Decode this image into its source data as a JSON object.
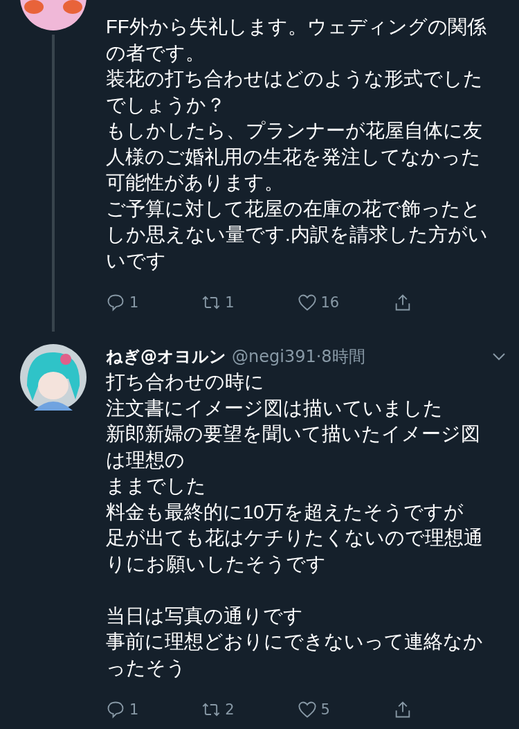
{
  "tweets": [
    {
      "paragraphs": [
        "FF外から失礼します。ウェディングの関係の者です。",
        "装花の打ち合わせはどのような形式でしたでしょうか？",
        "もしかしたら、プランナーが花屋自体に友人様のご婚礼用の生花を発注してなかった可能性があります。",
        "ご予算に対して花屋の在庫の花で飾ったとしか思えない量です.内訳を請求した方がいいです"
      ],
      "replies": "1",
      "retweets": "1",
      "likes": "16",
      "thread_line": true
    },
    {
      "name": "ねぎ@オヨルン",
      "handle": "@negi391",
      "time": "·8時間",
      "paragraphs": [
        "打ち合わせの時に",
        "注文書にイメージ図は描いていました",
        "新郎新婦の要望を聞いて描いたイメージ図は理想の",
        "ままでした",
        "料金も最終的に10万を超えたそうですが",
        "足が出ても花はケチりたくないので理想通りにお願いしたそうです",
        "当日は写真の通りです",
        "事前に理想どおりにできないって連絡なかったそう"
      ],
      "replies": "1",
      "retweets": "2",
      "likes": "5",
      "thread_line": false
    }
  ]
}
